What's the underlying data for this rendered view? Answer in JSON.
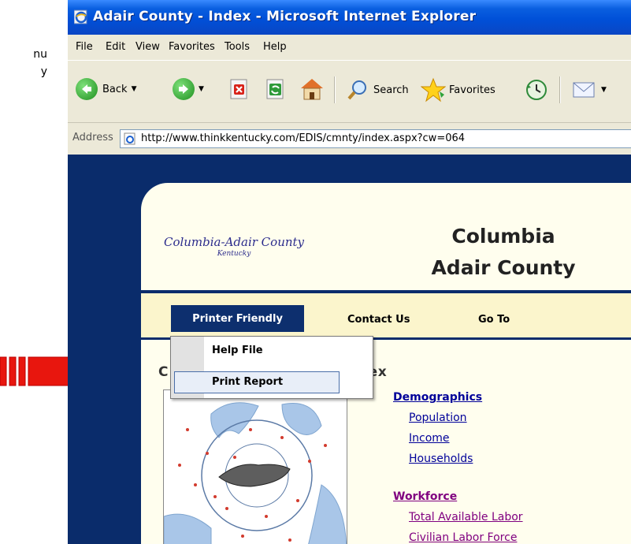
{
  "side_note": {
    "line1": "nu",
    "line2": "y"
  },
  "window": {
    "title": "Adair County - Index - Microsoft Internet Explorer",
    "menu": [
      "File",
      "Edit",
      "View",
      "Favorites",
      "Tools",
      "Help"
    ],
    "toolbar": {
      "back_label": "Back",
      "search_label": "Search",
      "favorites_label": "Favorites"
    },
    "address": {
      "label": "Address",
      "url": "http://www.thinkkentucky.com/EDIS/cmnty/index.aspx?cw=064"
    }
  },
  "site": {
    "logo_line1": "Columbia-Adair County",
    "logo_line2": "Kentucky",
    "title_line1": "Columbia",
    "title_line2": "Adair County",
    "nav": {
      "printer_friendly": "Printer Friendly",
      "contact_us": "Contact Us",
      "go_to": "Go To"
    },
    "page_title_left": "C",
    "page_title_right": "dex"
  },
  "dropdown": {
    "items": [
      "Help File",
      "Print Report"
    ],
    "highlighted": "Print Report"
  },
  "links": {
    "demographics": {
      "heading": "Demographics",
      "items": [
        "Population",
        "Income",
        "Households"
      ]
    },
    "workforce": {
      "heading": "Workforce",
      "items": [
        "Total Available Labor",
        "Civilian Labor Force"
      ]
    }
  },
  "colors": {
    "arrow": "#e8160e",
    "nav_dark": "#0a2c6b",
    "link": "#000099",
    "visited": "#800080",
    "titlebar": "#0a5fe0"
  }
}
